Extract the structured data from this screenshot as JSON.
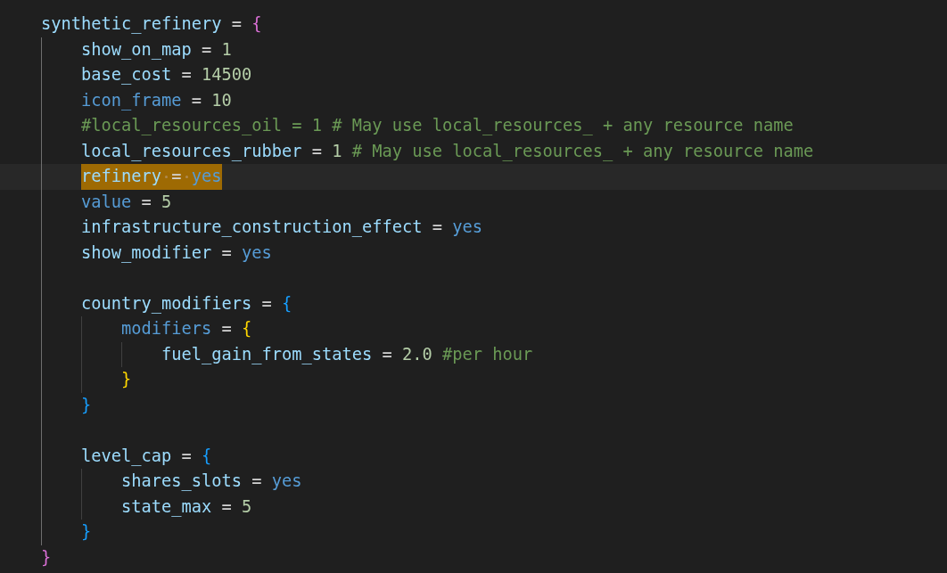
{
  "code": [
    {
      "kind": "code",
      "selected": false,
      "tokens": [
        {
          "kind": "name",
          "text": "synthetic_refinery"
        },
        {
          "kind": "op",
          "text": "="
        },
        {
          "kind": "brace",
          "text": "{",
          "color": "#da70d6"
        }
      ],
      "children": [
        {
          "kind": "code",
          "selected": false,
          "tokens": [
            {
              "kind": "name",
              "text": "show_on_map"
            },
            {
              "kind": "op",
              "text": "="
            },
            {
              "kind": "num",
              "text": "1"
            }
          ]
        },
        {
          "kind": "code",
          "selected": false,
          "tokens": [
            {
              "kind": "name",
              "text": "base_cost"
            },
            {
              "kind": "op",
              "text": "="
            },
            {
              "kind": "num",
              "text": "14500"
            }
          ]
        },
        {
          "kind": "code",
          "selected": false,
          "tokens": [
            {
              "kind": "key",
              "text": "icon_frame"
            },
            {
              "kind": "op",
              "text": "="
            },
            {
              "kind": "num",
              "text": "10"
            }
          ]
        },
        {
          "kind": "code",
          "selected": false,
          "tokens": [
            {
              "kind": "comment",
              "text": "#local_resources_oil = 1 # May use local_resources_ + any resource name"
            }
          ]
        },
        {
          "kind": "code",
          "selected": false,
          "tokens": [
            {
              "kind": "name",
              "text": "local_resources_rubber"
            },
            {
              "kind": "op",
              "text": "="
            },
            {
              "kind": "num",
              "text": "1"
            },
            {
              "kind": "comment",
              "text": "# May use local_resources_ + any resource name"
            }
          ]
        },
        {
          "kind": "code",
          "selected": true,
          "tokens": [
            {
              "kind": "name",
              "text": "refinery"
            },
            {
              "kind": "op",
              "text": "="
            },
            {
              "kind": "bool",
              "text": "yes"
            }
          ]
        },
        {
          "kind": "code",
          "selected": false,
          "tokens": [
            {
              "kind": "key",
              "text": "value"
            },
            {
              "kind": "op",
              "text": "="
            },
            {
              "kind": "num",
              "text": "5"
            }
          ]
        },
        {
          "kind": "code",
          "selected": false,
          "tokens": [
            {
              "kind": "name",
              "text": "infrastructure_construction_effect"
            },
            {
              "kind": "op",
              "text": "="
            },
            {
              "kind": "bool",
              "text": "yes"
            }
          ]
        },
        {
          "kind": "code",
          "selected": false,
          "tokens": [
            {
              "kind": "name",
              "text": "show_modifier"
            },
            {
              "kind": "op",
              "text": "="
            },
            {
              "kind": "bool",
              "text": "yes"
            }
          ]
        },
        {
          "kind": "blank"
        },
        {
          "kind": "code",
          "selected": false,
          "tokens": [
            {
              "kind": "name",
              "text": "country_modifiers"
            },
            {
              "kind": "op",
              "text": "="
            },
            {
              "kind": "brace",
              "text": "{",
              "color": "#179fff"
            }
          ],
          "children": [
            {
              "kind": "code",
              "selected": false,
              "tokens": [
                {
                  "kind": "key",
                  "text": "modifiers"
                },
                {
                  "kind": "op",
                  "text": "="
                },
                {
                  "kind": "brace",
                  "text": "{",
                  "color": "#ffd700"
                }
              ],
              "children": [
                {
                  "kind": "code",
                  "selected": false,
                  "tokens": [
                    {
                      "kind": "name",
                      "text": "fuel_gain_from_states"
                    },
                    {
                      "kind": "op",
                      "text": "="
                    },
                    {
                      "kind": "num",
                      "text": "2.0"
                    },
                    {
                      "kind": "comment",
                      "text": "#per hour"
                    }
                  ]
                }
              ],
              "close": {
                "kind": "code",
                "selected": false,
                "tokens": [
                  {
                    "kind": "brace",
                    "text": "}",
                    "color": "#ffd700"
                  }
                ]
              }
            }
          ],
          "close": {
            "kind": "code",
            "selected": false,
            "tokens": [
              {
                "kind": "brace",
                "text": "}",
                "color": "#179fff"
              }
            ]
          }
        },
        {
          "kind": "blank"
        },
        {
          "kind": "code",
          "selected": false,
          "tokens": [
            {
              "kind": "name",
              "text": "level_cap"
            },
            {
              "kind": "op",
              "text": "="
            },
            {
              "kind": "brace",
              "text": "{",
              "color": "#179fff"
            }
          ],
          "children": [
            {
              "kind": "code",
              "selected": false,
              "tokens": [
                {
                  "kind": "name",
                  "text": "shares_slots"
                },
                {
                  "kind": "op",
                  "text": "="
                },
                {
                  "kind": "bool",
                  "text": "yes"
                }
              ]
            },
            {
              "kind": "code",
              "selected": false,
              "tokens": [
                {
                  "kind": "name",
                  "text": "state_max"
                },
                {
                  "kind": "op",
                  "text": "="
                },
                {
                  "kind": "num",
                  "text": "5"
                }
              ]
            }
          ],
          "close": {
            "kind": "code",
            "selected": false,
            "tokens": [
              {
                "kind": "brace",
                "text": "}",
                "color": "#179fff"
              }
            ]
          }
        }
      ],
      "close": {
        "kind": "code",
        "selected": false,
        "tokens": [
          {
            "kind": "brace",
            "text": "}",
            "color": "#da70d6"
          }
        ]
      }
    }
  ]
}
